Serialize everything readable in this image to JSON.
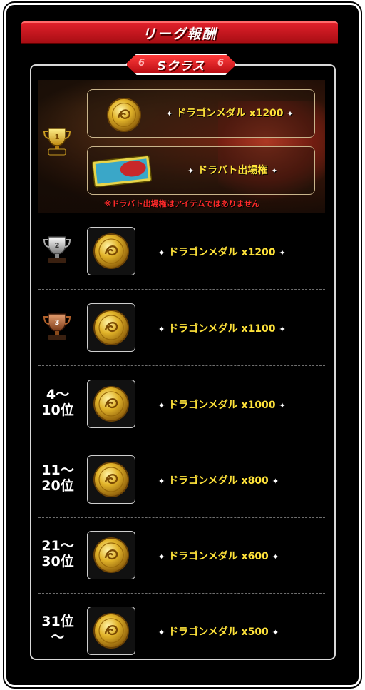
{
  "header": {
    "title": "リーグ報酬"
  },
  "class_badge": {
    "label": "Sクラス",
    "left_mark": "6",
    "right_mark": "6"
  },
  "first_place": {
    "rank_number": "1",
    "rewards": [
      {
        "label": "ドラゴンメダル x1200",
        "icon": "dragon-medal-icon"
      },
      {
        "label": "ドラバト出場権",
        "icon": "battle-ticket-icon"
      }
    ],
    "note": "※ドラバト出場権はアイテムではありません"
  },
  "rows": [
    {
      "rank_number": "2",
      "rank_text": "",
      "reward": "ドラゴンメダル x1200",
      "icon": "dragon-medal-icon"
    },
    {
      "rank_number": "3",
      "rank_text": "",
      "reward": "ドラゴンメダル x1100",
      "icon": "dragon-medal-icon"
    },
    {
      "rank_line1": "4〜",
      "rank_line2": "10位",
      "reward": "ドラゴンメダル x1000",
      "icon": "dragon-medal-icon"
    },
    {
      "rank_line1": "11〜",
      "rank_line2": "20位",
      "reward": "ドラゴンメダル x800",
      "icon": "dragon-medal-icon"
    },
    {
      "rank_line1": "21〜",
      "rank_line2": "30位",
      "reward": "ドラゴンメダル x600",
      "icon": "dragon-medal-icon"
    },
    {
      "rank_line1": "31位",
      "rank_line2": "〜",
      "reward": "ドラゴンメダル x500",
      "icon": "dragon-medal-icon"
    }
  ],
  "colors": {
    "reward_text": "#ffe33a",
    "title_red": "#d01c24",
    "note_red": "#ff2a2a",
    "background": "#000000"
  }
}
